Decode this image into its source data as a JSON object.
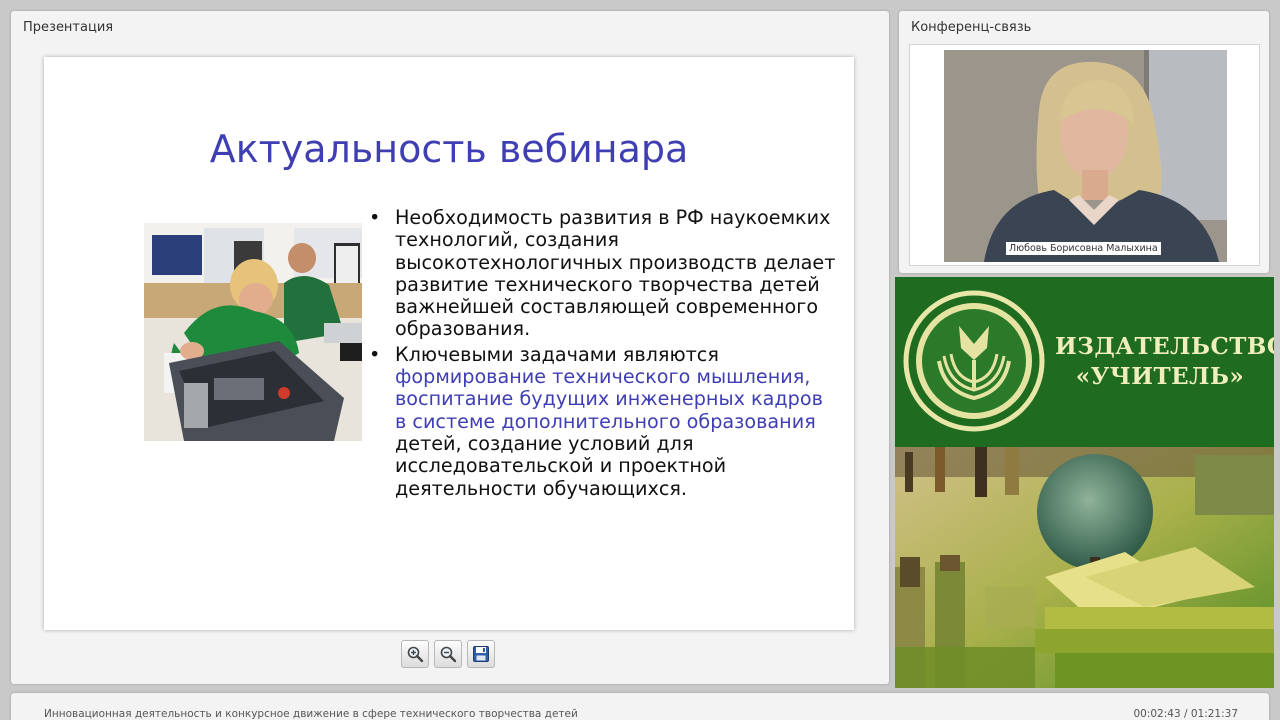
{
  "presentation": {
    "panel_title": "Презентация",
    "slide": {
      "title": "Актуальность вебинара",
      "bullet1": "Необходимость развития в РФ наукоемких технологий, создания высокотехнологичных производств делает развитие технического творчества детей важнейшей составляющей современного образования.",
      "bullet2_start": "Ключевыми задачами являются ",
      "bullet2_highlight": "формирование технического мышления, воспитание будущих инженерных кадров в системе дополнительного образования",
      "bullet2_end": " детей, создание условий для исследовательской и проектной деятельности обучающихся."
    },
    "toolbar": {
      "zoom_in_icon": "zoom-in-icon",
      "zoom_out_icon": "zoom-out-icon",
      "save_icon": "floppy-disk-icon"
    }
  },
  "conference": {
    "panel_title": "Конференц-связь",
    "speaker_name": "Любовь Борисовна Малыхина"
  },
  "banner": {
    "line1": "ИЗДАТЕЛЬСТВО",
    "line2": "«УЧИТЕЛЬ»"
  },
  "footer": {
    "webinar_title": "Инновационная деятельность и конкурсное движение в сфере технического творчества детей",
    "time": "00:02:43 / 01:21:37"
  },
  "colors": {
    "slide_accent": "#3f3fb3",
    "banner_green": "#1f6b1f",
    "banner_text": "#f0eebb"
  }
}
